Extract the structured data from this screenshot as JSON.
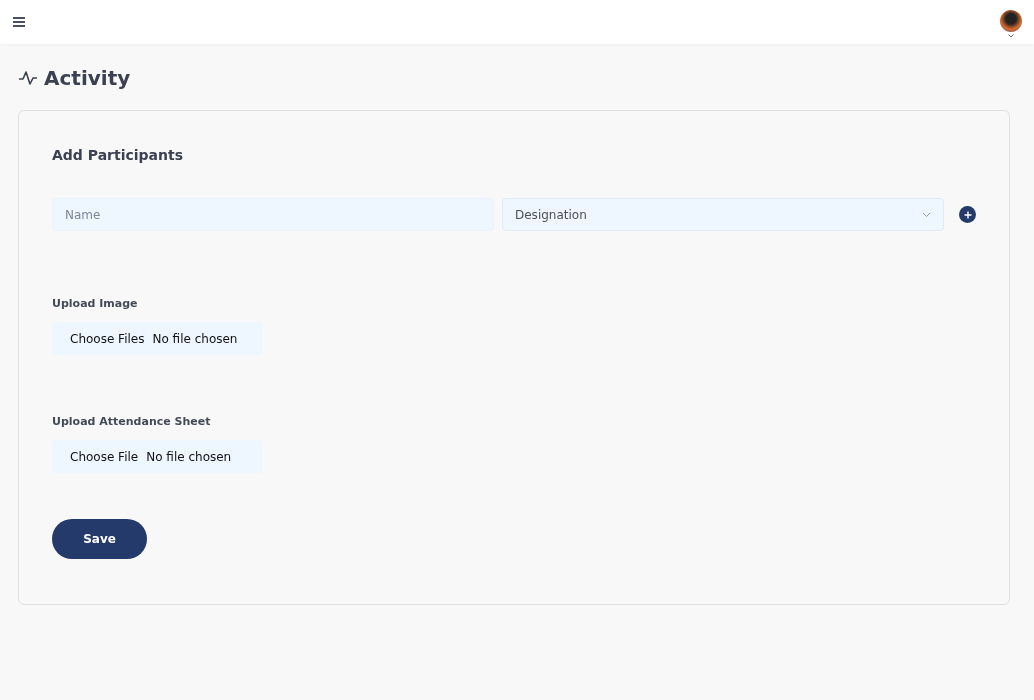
{
  "page_title": "Activity",
  "form": {
    "heading": "Add Participants",
    "name_field": {
      "placeholder": "Name"
    },
    "designation_select": {
      "value": "Designation"
    },
    "uploads": [
      {
        "label": "Upload Image",
        "button": "Choose Files",
        "status": "No file chosen"
      },
      {
        "label": "Upload Attendance Sheet",
        "button": "Choose File",
        "status": "No file chosen"
      }
    ],
    "save_button": "Save"
  }
}
